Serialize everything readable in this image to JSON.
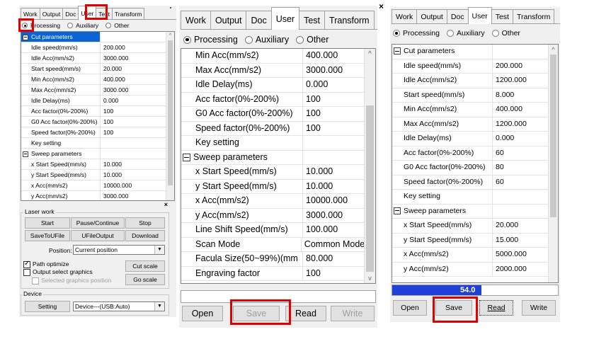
{
  "panel1": {
    "tabs": [
      "Work",
      "Output",
      "Doc",
      "User",
      "Test",
      "Transform"
    ],
    "radios": [
      {
        "label": "Processing",
        "checked": true
      },
      {
        "label": "Auxiliary",
        "checked": false
      },
      {
        "label": "Other",
        "checked": false
      }
    ],
    "rows": [
      {
        "type": "section",
        "label": "Cut parameters",
        "selected": true
      },
      {
        "label": "Idle speed(mm/s)",
        "value": "200.000"
      },
      {
        "label": "Idle Acc(mm/s2)",
        "value": "3000.000"
      },
      {
        "label": "Start speed(mm/s)",
        "value": "20.000"
      },
      {
        "label": "Min Acc(mm/s2)",
        "value": "400.000"
      },
      {
        "label": "Max Acc(mm/s2)",
        "value": "3000.000"
      },
      {
        "label": "Idle Delay(ms)",
        "value": "0.000"
      },
      {
        "label": "Acc factor(0%-200%)",
        "value": "100"
      },
      {
        "label": "G0 Acc factor(0%-200%)",
        "value": "100"
      },
      {
        "label": "Speed factor(0%-200%)",
        "value": "100"
      },
      {
        "label": "Key setting",
        "value": ""
      },
      {
        "type": "section",
        "label": "Sweep parameters"
      },
      {
        "label": "x Start Speed(mm/s)",
        "value": "10.000"
      },
      {
        "label": "y Start Speed(mm/s)",
        "value": "10.000"
      },
      {
        "label": "x Acc(mm/s2)",
        "value": "10000.000"
      },
      {
        "label": "y Acc(mm/s2)",
        "value": "3000.000"
      }
    ],
    "laser_work": {
      "title": "Laser work",
      "buttons": [
        "Start",
        "Pause/Continue",
        "Stop",
        "SaveToUFile",
        "UFileOutput",
        "Download"
      ],
      "position_label": "Position:",
      "position_value": "Current position",
      "path_optimize": "Path optimize",
      "output_select": "Output select graphics",
      "selected_graphics": "Selected graphics position",
      "cut_scale": "Cut scale",
      "go_scale": "Go scale"
    },
    "device": {
      "title": "Device",
      "setting": "Setting",
      "value": "Device---(USB:Auto)"
    }
  },
  "panel2": {
    "tabs": [
      "Work",
      "Output",
      "Doc",
      "User",
      "Test",
      "Transform"
    ],
    "radios": [
      {
        "label": "Processing",
        "checked": true
      },
      {
        "label": "Auxiliary",
        "checked": false
      },
      {
        "label": "Other",
        "checked": false
      }
    ],
    "rows": [
      {
        "label": "Min Acc(mm/s2)",
        "value": "400.000"
      },
      {
        "label": "Max Acc(mm/s2)",
        "value": "3000.000"
      },
      {
        "label": "Idle Delay(ms)",
        "value": "0.000"
      },
      {
        "label": "Acc factor(0%-200%)",
        "value": "100"
      },
      {
        "label": "G0 Acc factor(0%-200%)",
        "value": "100"
      },
      {
        "label": "Speed factor(0%-200%)",
        "value": "100"
      },
      {
        "label": "Key setting",
        "value": ""
      },
      {
        "type": "section",
        "label": "Sweep parameters"
      },
      {
        "label": "x Start Speed(mm/s)",
        "value": "10.000"
      },
      {
        "label": "y Start Speed(mm/s)",
        "value": "10.000"
      },
      {
        "label": "x Acc(mm/s2)",
        "value": "10000.000"
      },
      {
        "label": "y Acc(mm/s2)",
        "value": "3000.000"
      },
      {
        "label": "Line Shift Speed(mm/s)",
        "value": "100.000"
      },
      {
        "label": "Scan Mode",
        "value": "Common Mode"
      },
      {
        "label": "Facula Size(50~99%)(mm",
        "value": "80.000"
      },
      {
        "label": "Engraving factor",
        "value": "100"
      }
    ],
    "buttons": {
      "open": "Open",
      "save": "Save",
      "read": "Read",
      "write": "Write"
    }
  },
  "panel3": {
    "tabs": [
      "Work",
      "Output",
      "Doc",
      "User",
      "Test",
      "Transform"
    ],
    "radios": [
      {
        "label": "Processing",
        "checked": true
      },
      {
        "label": "Auxiliary",
        "checked": false
      },
      {
        "label": "Other",
        "checked": false
      }
    ],
    "rows": [
      {
        "type": "section",
        "label": "Cut parameters"
      },
      {
        "label": "Idle speed(mm/s)",
        "value": "200.000"
      },
      {
        "label": "Idle Acc(mm/s2)",
        "value": "1200.000"
      },
      {
        "label": "Start speed(mm/s)",
        "value": "8.000"
      },
      {
        "label": "Min Acc(mm/s2)",
        "value": "400.000"
      },
      {
        "label": "Max Acc(mm/s2)",
        "value": "1200.000"
      },
      {
        "label": "Idle Delay(ms)",
        "value": "0.000"
      },
      {
        "label": "Acc factor(0%-200%)",
        "value": "60"
      },
      {
        "label": "G0 Acc factor(0%-200%)",
        "value": "80"
      },
      {
        "label": "Speed factor(0%-200%)",
        "value": "60"
      },
      {
        "label": "Key setting",
        "value": ""
      },
      {
        "type": "section",
        "label": "Sweep parameters"
      },
      {
        "label": "x Start Speed(mm/s)",
        "value": "20.000"
      },
      {
        "label": "y Start Speed(mm/s)",
        "value": "15.000"
      },
      {
        "label": "x Acc(mm/s2)",
        "value": "5000.000"
      },
      {
        "label": "y Acc(mm/s2)",
        "value": "2000.000"
      }
    ],
    "progress_text": "54.0",
    "progress_fraction": 0.54,
    "progress_color": "#1e3fd8",
    "buttons": {
      "open": "Open",
      "save": "Save",
      "read": "Read",
      "write": "Write"
    }
  },
  "close_glyph": "×"
}
